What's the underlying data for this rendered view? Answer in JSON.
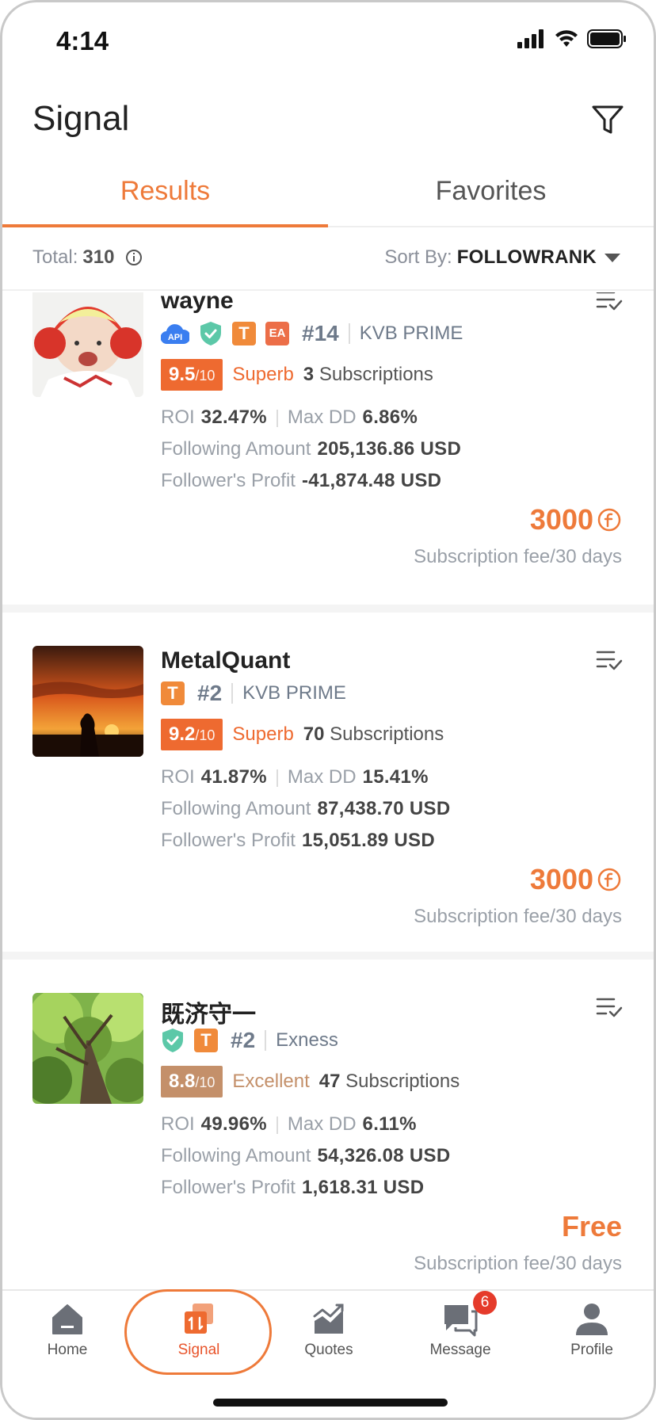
{
  "status_bar": {
    "time": "4:14"
  },
  "header": {
    "title": "Signal"
  },
  "tabs": [
    {
      "label": "Results",
      "active": true
    },
    {
      "label": "Favorites",
      "active": false
    }
  ],
  "summary": {
    "total_label": "Total:",
    "total_value": "310",
    "sort_label": "Sort By:",
    "sort_value": "FOLLOWRANK"
  },
  "signals": [
    {
      "name": "wayne",
      "badges": [
        "api",
        "verified",
        "T",
        "EA"
      ],
      "rank": "#14",
      "broker": "KVB PRIME",
      "score": "9.5",
      "score_den": "/10",
      "score_label": "Superb",
      "score_color": "#ee6a30",
      "subscriptions_count": "3",
      "subscriptions_label": "Subscriptions",
      "roi_label": "ROI",
      "roi": "32.47%",
      "maxdd_label": "Max DD",
      "maxdd": "6.86%",
      "following_label": "Following Amount",
      "following_amount": "205,136.86 USD",
      "profit_label": "Follower's Profit",
      "follower_profit": "-41,874.48 USD",
      "price": "3000",
      "fee_note": "Subscription fee/30 days"
    },
    {
      "name": "MetalQuant",
      "badges": [
        "T"
      ],
      "rank": "#2",
      "broker": "KVB PRIME",
      "score": "9.2",
      "score_den": "/10",
      "score_label": "Superb",
      "score_color": "#ee6a30",
      "subscriptions_count": "70",
      "subscriptions_label": "Subscriptions",
      "roi_label": "ROI",
      "roi": "41.87%",
      "maxdd_label": "Max DD",
      "maxdd": "15.41%",
      "following_label": "Following Amount",
      "following_amount": "87,438.70 USD",
      "profit_label": "Follower's Profit",
      "follower_profit": "15,051.89 USD",
      "price": "3000",
      "fee_note": "Subscription fee/30 days"
    },
    {
      "name": "既济守一",
      "badges": [
        "verified",
        "T"
      ],
      "rank": "#2",
      "broker": "Exness",
      "score": "8.8",
      "score_den": "/10",
      "score_label": "Excellent",
      "score_color": "#c4906a",
      "subscriptions_count": "47",
      "subscriptions_label": "Subscriptions",
      "roi_label": "ROI",
      "roi": "49.96%",
      "maxdd_label": "Max DD",
      "maxdd": "6.11%",
      "following_label": "Following Amount",
      "following_amount": "54,326.08 USD",
      "profit_label": "Follower's Profit",
      "follower_profit": "1,618.31 USD",
      "price": "Free",
      "fee_note": "Subscription fee/30 days"
    }
  ],
  "bottom_nav": [
    {
      "label": "Home",
      "icon": "home-icon"
    },
    {
      "label": "Signal",
      "icon": "signal-icon",
      "active": true
    },
    {
      "label": "Quotes",
      "icon": "chart-icon"
    },
    {
      "label": "Message",
      "icon": "message-icon",
      "badge": "6"
    },
    {
      "label": "Profile",
      "icon": "profile-icon"
    }
  ],
  "colors": {
    "accent": "#ee7a3a",
    "excellent": "#c4906a",
    "badge_red": "#e53b2b"
  }
}
